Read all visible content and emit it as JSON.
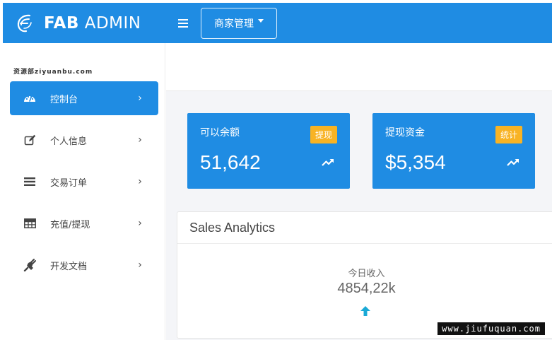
{
  "brand": {
    "bold": "FAB",
    "light": "ADMIN"
  },
  "topbar": {
    "merchant_menu": "商家管理"
  },
  "sidebar": {
    "site_tag": "资源部ziyuanbu.com",
    "items": [
      {
        "label": "控制台",
        "icon": "dashboard-icon",
        "active": true
      },
      {
        "label": "个人信息",
        "icon": "edit-icon",
        "active": false
      },
      {
        "label": "交易订单",
        "icon": "list-icon",
        "active": false
      },
      {
        "label": "充值/提现",
        "icon": "table-icon",
        "active": false
      },
      {
        "label": "开发文档",
        "icon": "plug-icon",
        "active": false
      }
    ],
    "chevron": "›"
  },
  "cards": [
    {
      "title": "可以余额",
      "badge": "提现",
      "value": "51,642"
    },
    {
      "title": "提现资金",
      "badge": "统计",
      "value": "$5,354"
    }
  ],
  "analytics": {
    "title": "Sales Analytics",
    "today_label": "今日收入",
    "today_value": "4854,22k"
  },
  "watermark": "www.jiufuquan.com",
  "colors": {
    "primary": "#1f8ce3",
    "badge": "#f8b324",
    "arrow": "#1aa9d6"
  }
}
